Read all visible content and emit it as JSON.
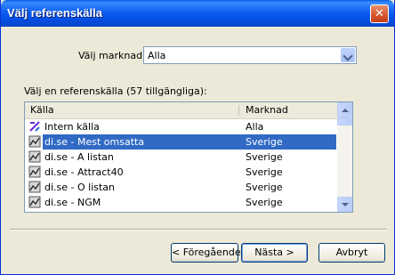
{
  "window": {
    "title": "Välj referenskälla",
    "close_symbol": "✕"
  },
  "market": {
    "label": "Välj marknad:",
    "selected": "Alla"
  },
  "list": {
    "label": "Välj en referenskälla (57 tillgängliga):",
    "columns": [
      "Källa",
      "Marknad"
    ],
    "rows": [
      {
        "source": "Intern källa",
        "market": "Alla",
        "icon": "internal-source-icon",
        "selected": false
      },
      {
        "source": "di.se - Mest omsatta",
        "market": "Sverige",
        "icon": "web-source-icon",
        "selected": true
      },
      {
        "source": "di.se - A listan",
        "market": "Sverige",
        "icon": "web-source-icon",
        "selected": false
      },
      {
        "source": "di.se - Attract40",
        "market": "Sverige",
        "icon": "web-source-icon",
        "selected": false
      },
      {
        "source": "di.se - O listan",
        "market": "Sverige",
        "icon": "web-source-icon",
        "selected": false
      },
      {
        "source": "di.se - NGM",
        "market": "Sverige",
        "icon": "web-source-icon",
        "selected": false
      }
    ]
  },
  "buttons": {
    "back": "< Föregående",
    "next": "Nästa >",
    "cancel": "Avbryt"
  },
  "colors": {
    "titlebar": "#0a5fe0",
    "selection": "#316ac5",
    "dialog_bg": "#ece9d8"
  }
}
